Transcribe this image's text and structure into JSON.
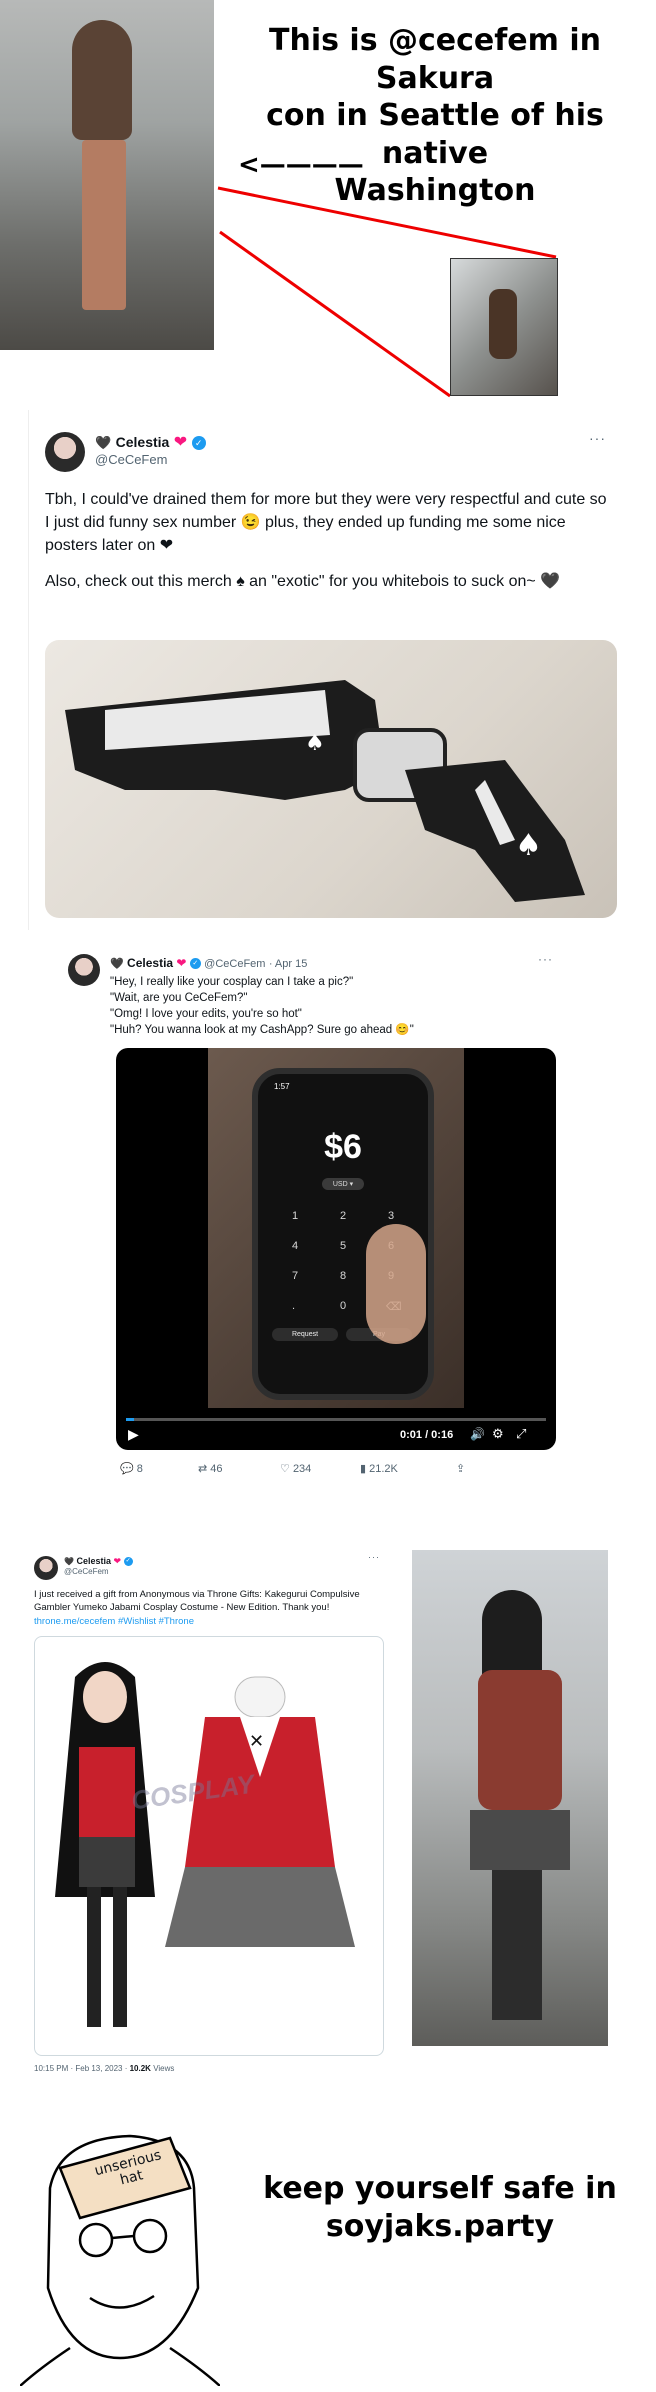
{
  "caption_top": {
    "line1": "This is @cecefem in Sakura",
    "line2": "con in Seattle of his native",
    "line3": "Washington",
    "arrow": "<————"
  },
  "tweet1": {
    "name": "Celestia",
    "handle": "@CeCeFem",
    "text1": "Tbh, I could've drained them for more but they were very respectful and cute so I just did funny sex number 😉 plus, they ended up funding me some nice posters later on ❤",
    "text2": "Also, check out this merch ♠ an \"exotic\" for you whitebois to suck on~ 🖤",
    "more": "···"
  },
  "tweet2": {
    "name": "Celestia",
    "handle": "@CeCeFem",
    "date": "· Apr 15",
    "lines": [
      "\"Hey, I really like your cosplay can I take a pic?\"",
      "\"Wait, are you CeCeFem?\"",
      "\"Omg! I love your edits, you're so hot\"",
      "\"Huh? You wanna look at my CashApp? Sure go ahead 😊\""
    ],
    "more": "···",
    "phone_amount": "$6",
    "phone_currency": "USD ▾",
    "phone_keys": [
      "1",
      "2",
      "3",
      "4",
      "5",
      "6",
      "7",
      "8",
      "9",
      ".",
      "0",
      "⌫"
    ],
    "phone_request": "Request",
    "phone_pay": "Pay",
    "phone_time": "1:57",
    "video_time": "0:01 / 0:16",
    "stats": {
      "replies": "8",
      "retweets": "46",
      "likes": "234",
      "views": "21.2K"
    }
  },
  "tweet3": {
    "name": "Celestia",
    "handle": "@CeCeFem",
    "text": "I just received a gift from Anonymous via Throne Gifts: Kakegurui Compulsive Gambler Yumeko Jabami Cosplay Costume - New Edition. Thank you!",
    "link": "throne.me/cecefem #Wishlist #Throne",
    "footer_time": "10:15 PM · Feb 13, 2023 · ",
    "footer_views": "10.2K",
    "footer_views_label": " Views",
    "watermark": "COSPLAY",
    "more": "···"
  },
  "bottom": {
    "hat_label": "unserious hat",
    "caption_line1": "keep yourself safe in",
    "caption_line2": "soyjaks.party"
  }
}
